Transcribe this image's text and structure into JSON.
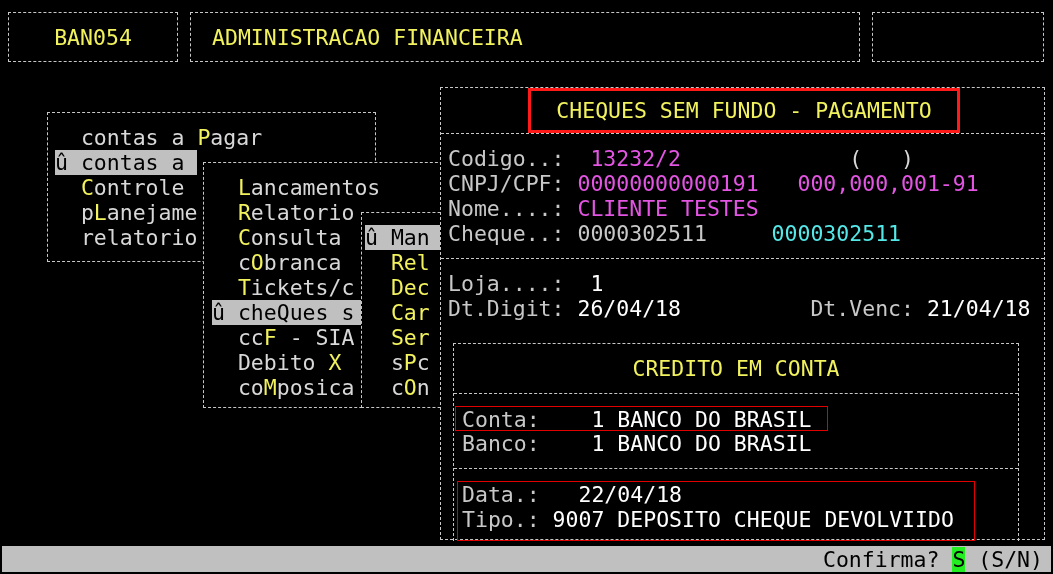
{
  "header": {
    "program_code": "BAN054",
    "title": "ADMINISTRACAO FINANCEIRA"
  },
  "menus": [
    {
      "items": [
        {
          "before": "contas a ",
          "hotkey": "P",
          "after": "agar",
          "selected": false
        },
        {
          "before": "û contas a",
          "selected": true
        },
        {
          "hotkey": "C",
          "after": "ontrole",
          "selected": false
        },
        {
          "before": "p",
          "hotkey": "L",
          "after": "anejame",
          "selected": false
        },
        {
          "before": "relatorio",
          "selected": false
        }
      ]
    },
    {
      "items": [
        {
          "hotkey": "L",
          "after": "ancamentos",
          "selected": false
        },
        {
          "hotkey": "R",
          "after": "elatorio",
          "selected": false
        },
        {
          "hotkey": "C",
          "after": "onsulta",
          "selected": false
        },
        {
          "before": "c",
          "hotkey": "O",
          "after": "branca",
          "selected": false
        },
        {
          "hotkey": "T",
          "after": "ickets/c",
          "selected": false
        },
        {
          "before": "û cheQues s",
          "selected": true
        },
        {
          "before": "cc",
          "hotkey": "F",
          "after": " - SIA",
          "selected": false
        },
        {
          "before": "Debito ",
          "hotkey": "X",
          "selected": false
        },
        {
          "before": "co",
          "hotkey": "M",
          "after": "posica",
          "selected": false
        }
      ]
    },
    {
      "items": [
        {
          "before": "û Man",
          "selected": true
        },
        {
          "hotkey": "Rel",
          "selected": false
        },
        {
          "hotkey": "Dec",
          "selected": false
        },
        {
          "hotkey": "Car",
          "selected": false
        },
        {
          "hotkey": "Ser",
          "selected": false
        },
        {
          "before": "s",
          "hotkey": "P",
          "after": "c",
          "selected": false
        },
        {
          "before": "c",
          "hotkey": "O",
          "after": "n",
          "selected": false
        }
      ]
    }
  ],
  "panel": {
    "title": "CHEQUES SEM FUNDO - PAGAMENTO",
    "title_annotated": true,
    "sections": [
      {
        "rows": [
          [
            {
              "kind": "label",
              "text": "Codigo..:"
            },
            {
              "kind": "value",
              "text": "13232/2",
              "color": "#e455e4"
            },
            {
              "kind": "value",
              "text": "(   )",
              "color": "#d8d8d8"
            }
          ],
          [
            {
              "kind": "label",
              "text": "CNPJ/CPF:"
            },
            {
              "kind": "value",
              "text": "00000000000191",
              "color": "#e455e4"
            },
            {
              "kind": "value",
              "text": "000,000,001-91",
              "color": "#e455e4"
            }
          ],
          [
            {
              "kind": "label",
              "text": "Nome....:"
            },
            {
              "kind": "value",
              "text": "CLIENTE TESTES",
              "color": "#e455e4"
            }
          ],
          [
            {
              "kind": "label",
              "text": "Cheque..:"
            },
            {
              "kind": "value",
              "text": "0000302511",
              "color": "#c8c8c8"
            },
            {
              "kind": "value",
              "text": "0000302511",
              "color": "#55e8e8"
            }
          ]
        ]
      },
      {
        "rows": [
          [
            {
              "kind": "label",
              "text": "Loja....:"
            },
            {
              "kind": "value",
              "text": "1",
              "color": "#ffffff"
            }
          ],
          [
            {
              "kind": "label",
              "text": "Dt.Digit:"
            },
            {
              "kind": "value",
              "text": "26/04/18",
              "color": "#ffffff"
            },
            {
              "kind": "label",
              "text": "Dt.Venc:"
            },
            {
              "kind": "value",
              "text": "21/04/18",
              "color": "#ffffff"
            }
          ]
        ]
      }
    ],
    "credit": {
      "title": "CREDITO EM CONTA",
      "sections": [
        {
          "annotated": false,
          "rows": [
            {
              "annotated": true,
              "cells": [
                {
                  "kind": "label",
                  "text": "Conta:"
                },
                {
                  "kind": "value",
                  "text": "1 BANCO DO BRASIL",
                  "color": "#ffffff"
                }
              ]
            },
            {
              "annotated": false,
              "cells": [
                {
                  "kind": "label",
                  "text": "Banco:"
                },
                {
                  "kind": "value",
                  "text": "1 BANCO DO BRASIL",
                  "color": "#ffffff"
                }
              ]
            }
          ]
        },
        {
          "annotated": true,
          "rows": [
            {
              "annotated": false,
              "cells": [
                {
                  "kind": "label",
                  "text": "Data.:"
                },
                {
                  "kind": "value",
                  "text": "22/04/18",
                  "color": "#ffffff"
                }
              ]
            },
            {
              "annotated": false,
              "cells": [
                {
                  "kind": "label",
                  "text": "Tipo.:"
                },
                {
                  "kind": "value",
                  "text": "9007 DEPOSITO CHEQUE DEVOLVIIDO",
                  "color": "#ffffff"
                }
              ]
            }
          ]
        }
      ]
    }
  },
  "status_bar": {
    "prompt": "Confirma?",
    "answer": "S",
    "options": "(S/N)"
  }
}
